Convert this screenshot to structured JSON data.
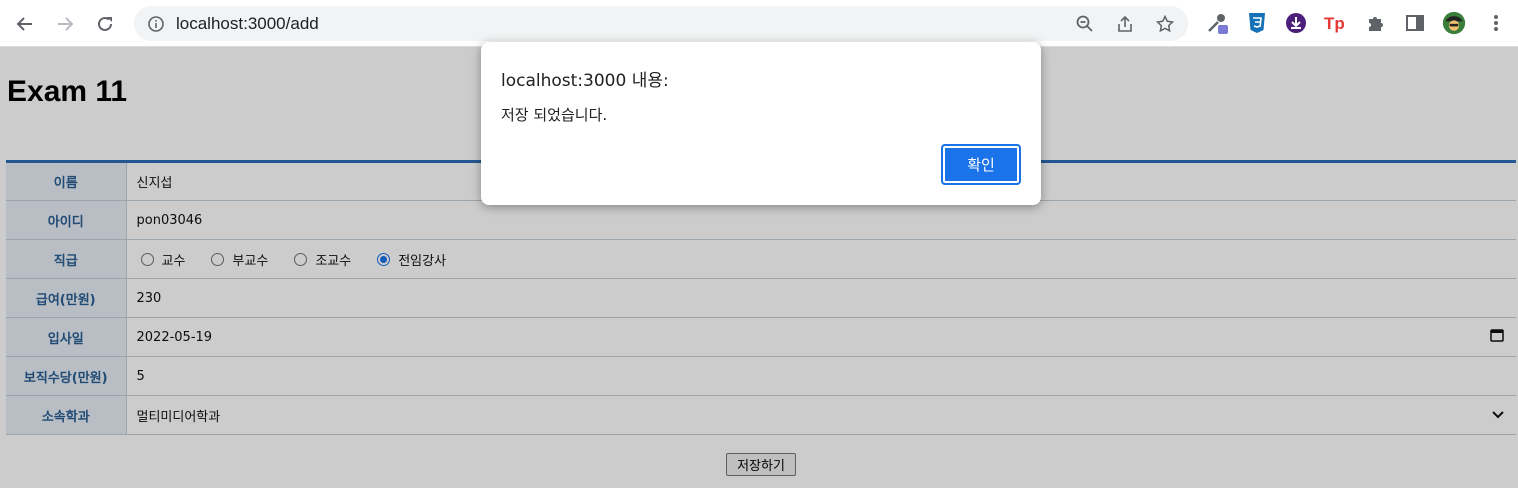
{
  "browser": {
    "url": "localhost:3000/add"
  },
  "page": {
    "title": "Exam 11",
    "fields": {
      "name_label": "이름",
      "name_value": "신지섭",
      "id_label": "아이디",
      "id_value": "pon03046",
      "rank_label": "직급",
      "rank_options": [
        "교수",
        "부교수",
        "조교수",
        "전임강사"
      ],
      "rank_selected": "전임강사",
      "salary_label": "급여(만원)",
      "salary_value": "230",
      "hire_label": "입사일",
      "hire_value": "2022-05-19",
      "bonus_label": "보직수당(만원)",
      "bonus_value": "5",
      "dept_label": "소속학과",
      "dept_value": "멀티미디어학과"
    },
    "save_button": "저장하기"
  },
  "dialog": {
    "origin": "localhost:3000 내용:",
    "message": "저장 되었습니다.",
    "ok_label": "확인"
  },
  "colors": {
    "header_border": "#2c6db6",
    "label_text": "#2a5d92",
    "accent": "#1a73e8"
  }
}
